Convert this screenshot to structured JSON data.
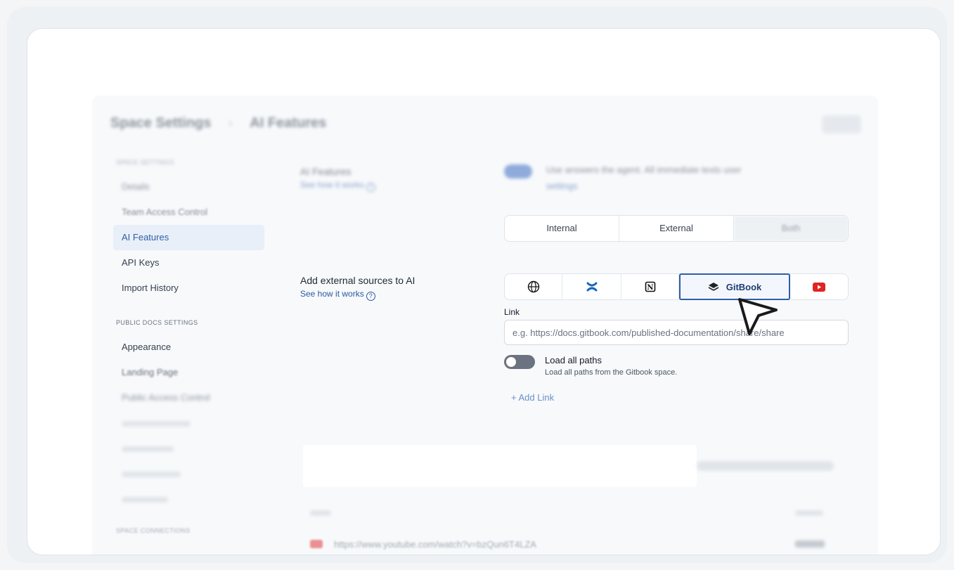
{
  "header": {
    "breadcrumb_root": "Space Settings",
    "breadcrumb_current": "AI Features"
  },
  "sidebar": {
    "group1_title": "Space Settings",
    "group1_items": [
      {
        "label": "Details",
        "blurred": true
      },
      {
        "label": "Team Access Control",
        "blurred": true
      },
      {
        "label": "AI Features",
        "active": true
      },
      {
        "label": "API Keys"
      },
      {
        "label": "Import History"
      }
    ],
    "group2_title": "PUBLIC DOCS SETTINGS",
    "group2_items": [
      {
        "label": "Appearance"
      },
      {
        "label": "Landing Page"
      },
      {
        "label": "Public Access Control",
        "blurred": true
      }
    ],
    "group3_title": "SPACE CONNECTIONS"
  },
  "ai_features": {
    "title": "AI Features",
    "see_how": "See how it works",
    "toggle_text": "Use answers the agent. All immediate texts user",
    "settings_link": "settings"
  },
  "audience_tabs": [
    "Internal",
    "External",
    "Both"
  ],
  "external_sources": {
    "title": "Add external sources to AI",
    "see_how": "See how it works",
    "sources": [
      {
        "name": "globe-icon",
        "label": ""
      },
      {
        "name": "confluence-icon",
        "label": ""
      },
      {
        "name": "notion-icon",
        "label": ""
      },
      {
        "name": "gitbook-icon",
        "label": "GitBook",
        "selected": true
      },
      {
        "name": "youtube-icon",
        "label": ""
      }
    ],
    "link_label": "Link",
    "link_placeholder": "e.g. https://docs.gitbook.com/published-documentation/share/share",
    "toggle_title": "Load all paths",
    "toggle_desc": "Load all paths from the Gitbook space.",
    "add_link": "+ Add Link"
  },
  "table": {
    "row_url": "https://www.youtube.com/watch?v=bzQun6T4LZA"
  },
  "colors": {
    "accent": "#2f5ea8",
    "youtube_red": "#e02424",
    "confluence_blue": "#1565c0"
  }
}
